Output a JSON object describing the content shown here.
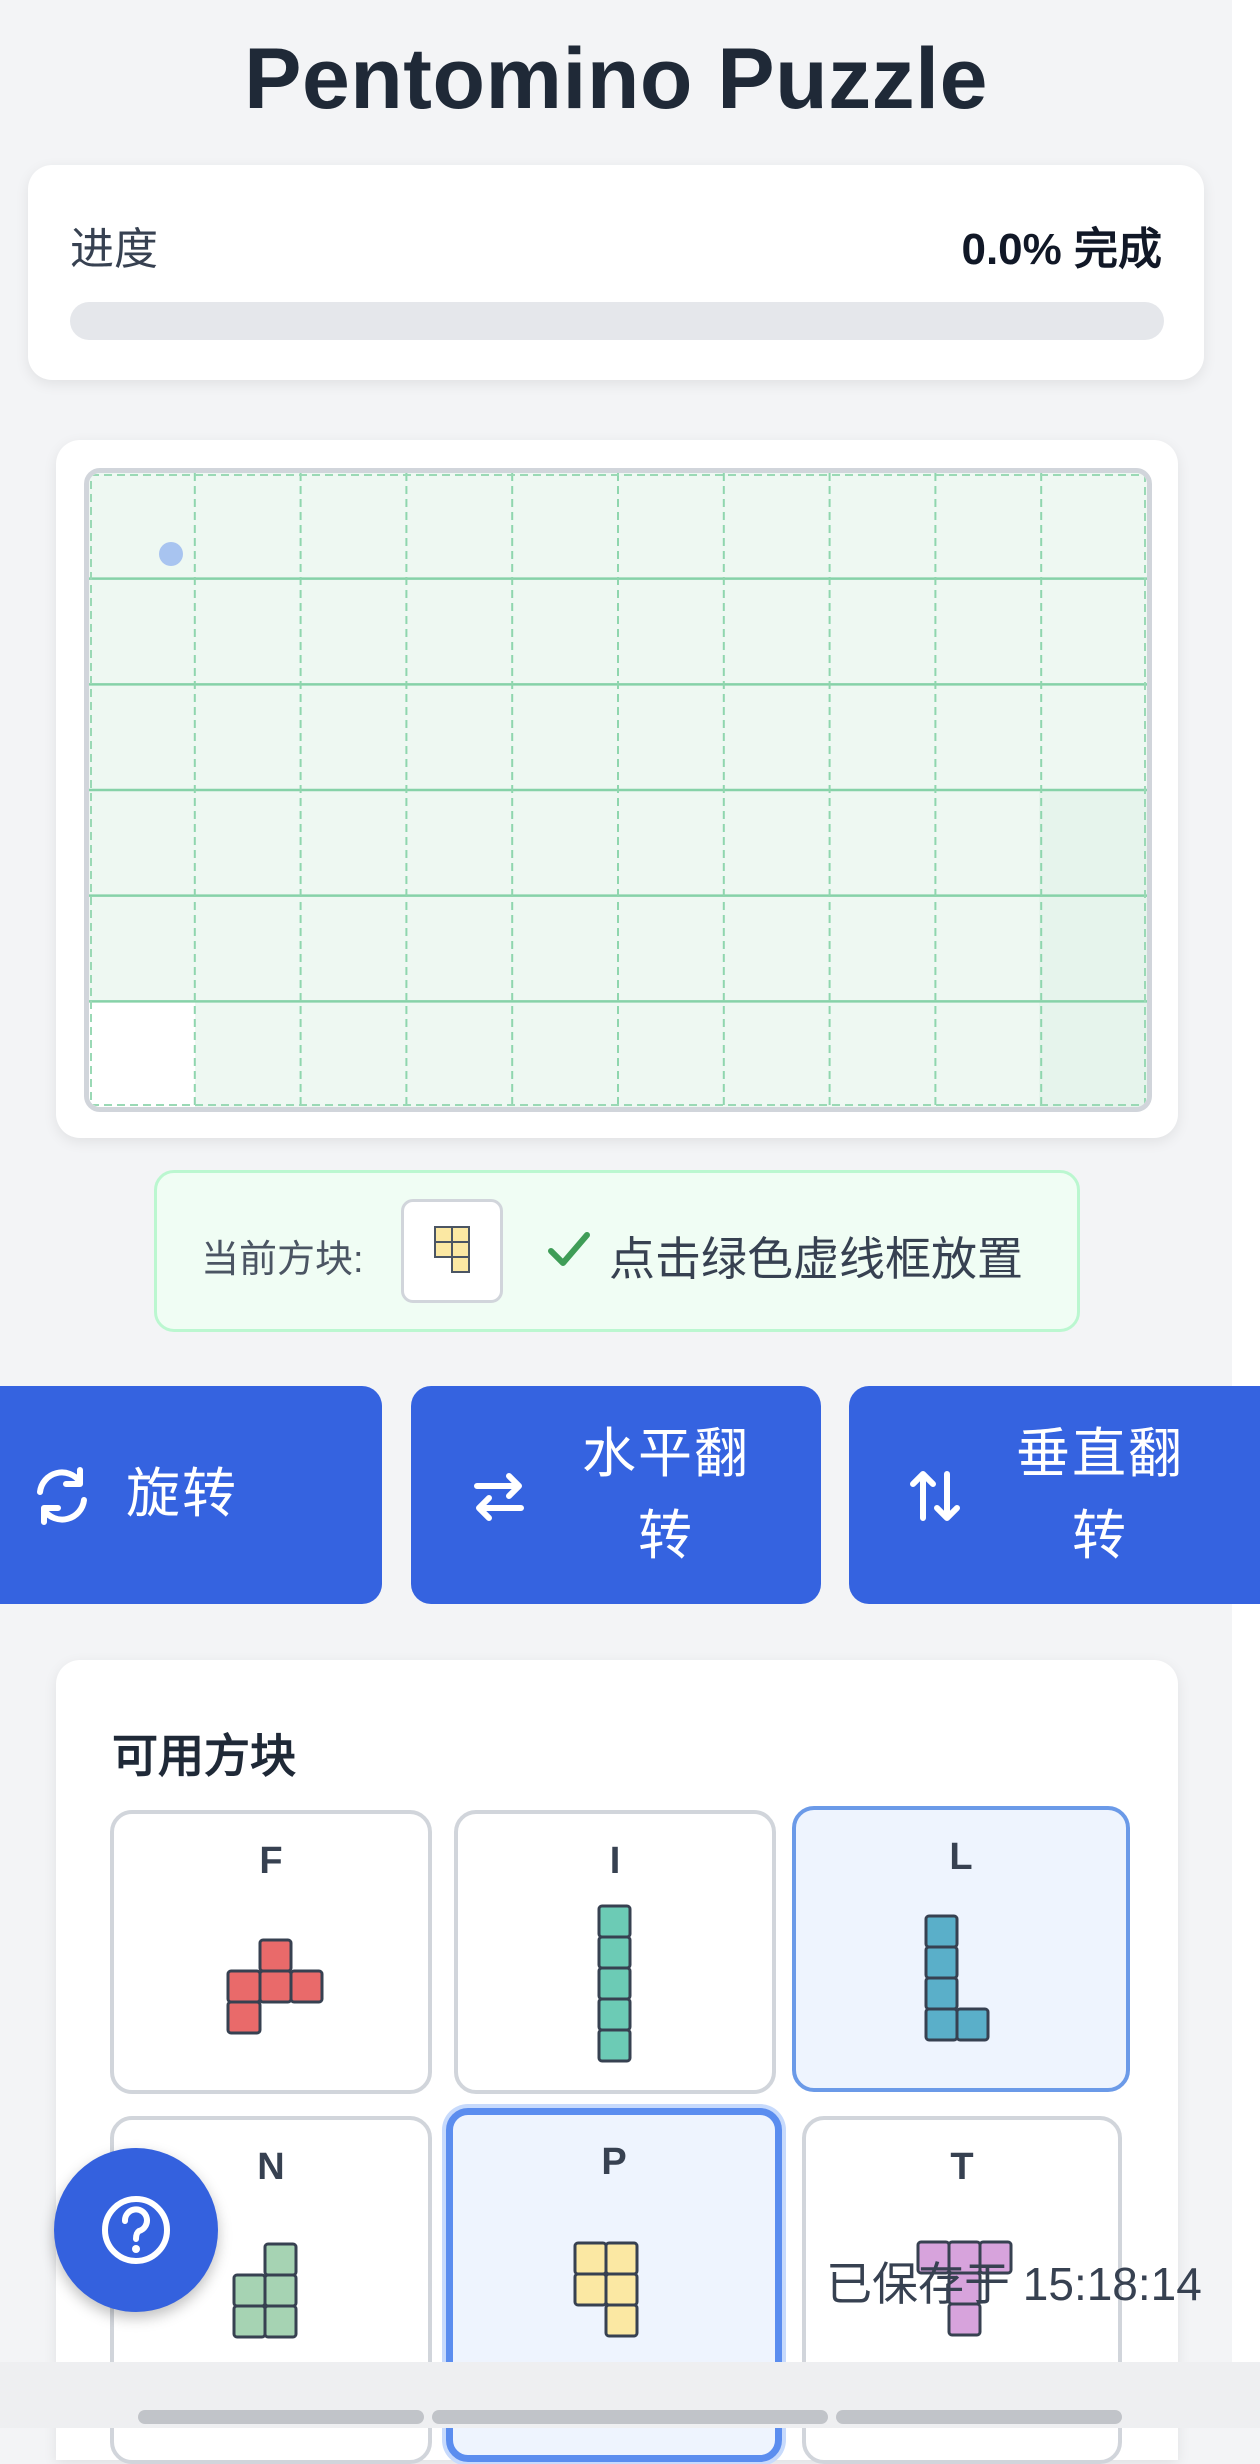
{
  "app": {
    "title": "Pentomino Puzzle"
  },
  "progress": {
    "label": "进度",
    "value_text": "0.0% 完成",
    "percent": 0.0
  },
  "board": {
    "rows": 6,
    "cols": 10
  },
  "current": {
    "label": "当前方块:",
    "piece": "P",
    "hint": "点击绿色虚线框放置"
  },
  "controls": {
    "rotate_label": "旋转",
    "hflip_line1": "水平翻",
    "hflip_line2": "转",
    "vflip_line1": "垂直翻",
    "vflip_line2": "转",
    "rotate_icon": "rotate-icon",
    "hflip_icon": "horizontal-flip-icon",
    "vflip_icon": "vertical-flip-icon"
  },
  "pieces": {
    "title": "可用方块",
    "items": [
      {
        "label": "F",
        "color": "#e96a6a",
        "state": "normal"
      },
      {
        "label": "I",
        "color": "#6ccbb5",
        "state": "normal"
      },
      {
        "label": "L",
        "color": "#5aafc9",
        "state": "selected"
      },
      {
        "label": "N",
        "color": "#a6d3b3",
        "state": "normal"
      },
      {
        "label": "P",
        "color": "#fbe8a3",
        "state": "active"
      },
      {
        "label": "T",
        "color": "#d7a3dc",
        "state": "normal"
      }
    ]
  },
  "help": {
    "icon": "help-icon"
  },
  "status": {
    "saved_text": "已保存于 15:18:14"
  }
}
